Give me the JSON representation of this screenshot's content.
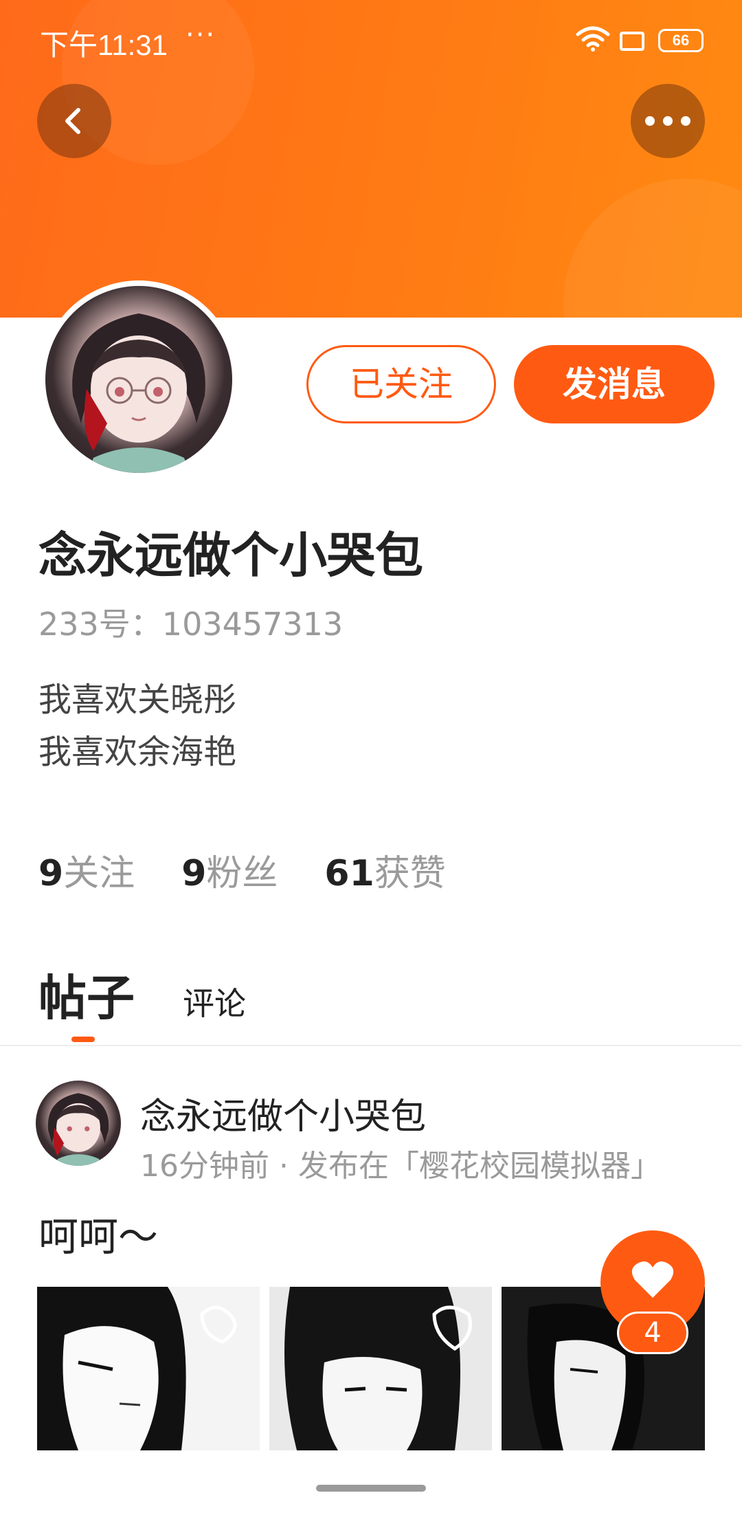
{
  "status_bar": {
    "time": "下午11:31",
    "dots": "···",
    "battery": "66",
    "icons": [
      "wifi-icon",
      "screen-icon",
      "battery-icon"
    ]
  },
  "header": {
    "accent_color": "#ff5a12",
    "back_icon": "chevron-left-icon",
    "more_icon": "more-dots-icon"
  },
  "profile": {
    "follow_label": "已关注",
    "message_label": "发消息",
    "name": "念永远做个小哭包",
    "uid": "233号：103457313",
    "bio_line1": "我喜欢关晓彤",
    "bio_line2": "我喜欢余海艳",
    "stats": {
      "following_count": "9",
      "following_label": "关注",
      "fans_count": "9",
      "fans_label": "粉丝",
      "likes_count": "61",
      "likes_label": "获赞"
    }
  },
  "tabs": {
    "posts": "帖子",
    "comments": "评论"
  },
  "post": {
    "author": "念永远做个小哭包",
    "meta": "16分钟前 · 发布在「樱花校园模拟器」",
    "text": "呵呵～",
    "like_count": "4",
    "like_icon": "heart-icon"
  }
}
